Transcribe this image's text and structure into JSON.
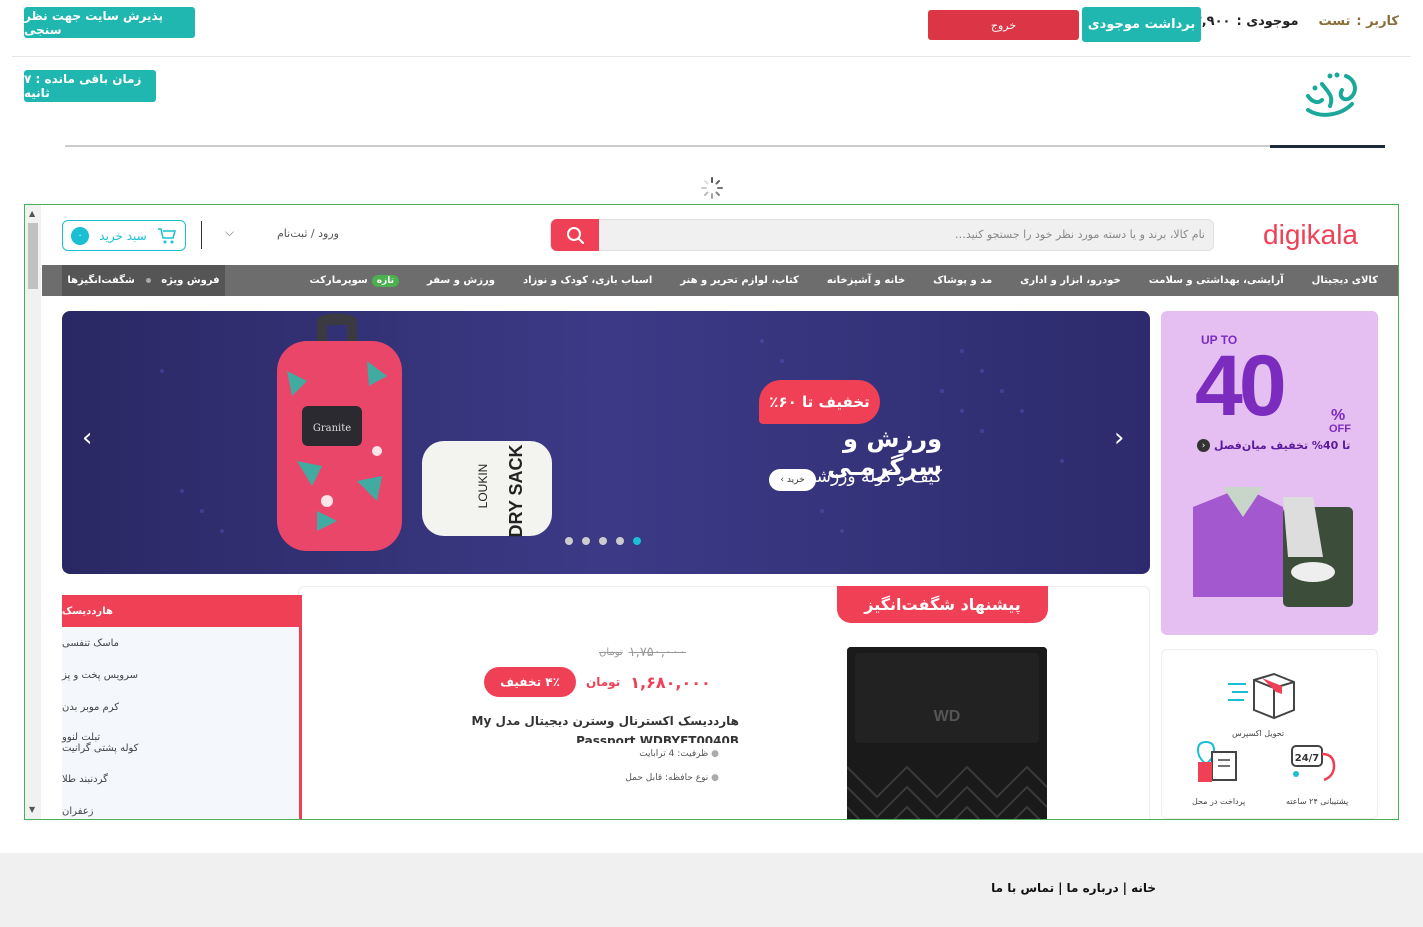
{
  "topbar": {
    "accept_button": "پذیرش سایت جهت نظر سنجی",
    "logout_button": "خروج",
    "withdraw_button": "برداشت موجودی",
    "balance_label": "موجودی :",
    "balance_value": "۲,۹۰۰ ریال",
    "user_label": "کاربر :",
    "user_name": "تست",
    "timer": "زمان باقی مانده : ۷ ثانیه",
    "brand": "سنجش وب"
  },
  "colors": {
    "teal": "#1fb7b0",
    "red": "#dc3545",
    "dk_red": "#ef4056",
    "dk_cyan": "#19bfd3"
  },
  "site": {
    "logo_prefix": "digi",
    "logo_suffix": "kala",
    "search_placeholder": "نام کالا، برند و یا دسته مورد نظر خود را جستجو کنید…",
    "login": "ورود / ثبت‌نام",
    "cart_label": "سبد خرید",
    "cart_count": "۰",
    "nav": [
      "کالای دیجیتال",
      "آرایشی، بهداشتی و سلامت",
      "خودرو، ابزار و اداری",
      "مد و پوشاک",
      "خانه و آشپزخانه",
      "کتاب، لوازم تحریر و هنر",
      "اسباب بازی، کودک و نوزاد",
      "ورزش و سفر",
      "سوپرمارکت"
    ],
    "nav_new_badge": "تازه",
    "nav_special_1": "فروش ویژه",
    "nav_special_2": "شگفت‌انگیزها",
    "hero": {
      "discount": "تخفیف تا ۶۰٪",
      "title": "ورزش و سرگرمـی",
      "subtitle": "کیف و کوله ورزشی",
      "buy": "خرید",
      "bag_brand": "Granite",
      "sack_text": "DRY SACK",
      "sack_brand": "LOUKIN"
    },
    "promo": {
      "upto": "UP TO",
      "big": "40",
      "pct": "%",
      "off": "OFF",
      "caption": "تا 40% تخفیف میان‌فصل"
    },
    "services": [
      {
        "label": "تحویل اکسپرس",
        "icon": "express-delivery-icon"
      },
      {
        "label": "پشتیبانی ۲۴ ساعته",
        "icon": "support-24-icon"
      },
      {
        "label": "پرداخت در محل",
        "icon": "cash-on-delivery-icon"
      }
    ],
    "amazing": {
      "title": "پیشنهاد شگفت‌انگیز",
      "old_price": "۱,۷۵۰,۰۰۰",
      "old_unit": "تومان",
      "price": "۱,۶۸۰,۰۰۰",
      "unit": "تومان",
      "discount": "۴٪ تخفیف",
      "product_name_1": "هارددیسک اکسترنال وسترن دیجیتال مدل My",
      "product_name_2": "Passport WDBYFT0040B",
      "spec_1": "ظرفیت: 4 ترابایت",
      "spec_2": "نوع حافظه: قابل حمل",
      "hdd_logo": "WD"
    },
    "side_list": [
      "هارددیسک",
      "ماسک تنفسی",
      "سرویس پخت و پز",
      "کرم موبر بدن",
      "تبلت لنوو",
      "کوله پشتی گرانیت",
      "گردنبند طلا",
      "زعفران"
    ]
  },
  "footer": {
    "home": "خانه",
    "about": "درباره ما",
    "contact": "تماس با ما",
    "sep": "|"
  }
}
